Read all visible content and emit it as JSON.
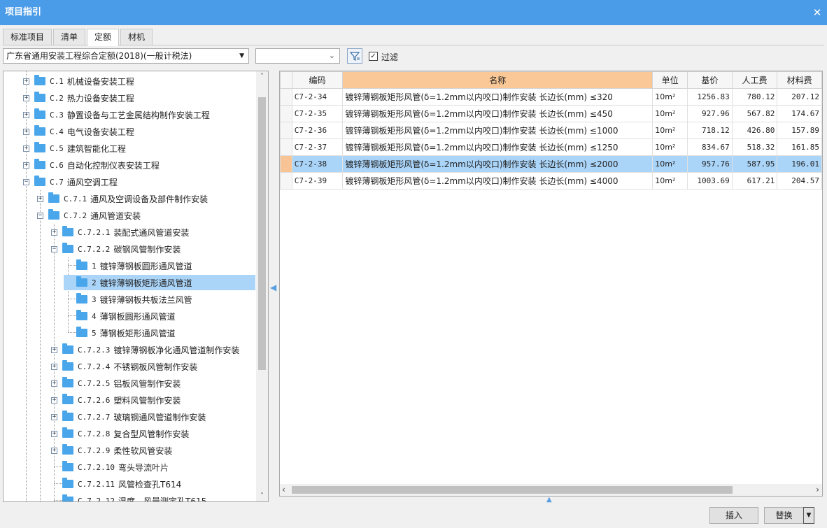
{
  "window": {
    "title": "项目指引",
    "close_glyph": "✕"
  },
  "tabs": [
    {
      "label": "标准项目",
      "active": false
    },
    {
      "label": "清单",
      "active": false
    },
    {
      "label": "定额",
      "active": true
    },
    {
      "label": "材机",
      "active": false
    }
  ],
  "toolbar": {
    "quota_library": "广东省通用安装工程综合定额(2018)(一般计税法)",
    "filter_value": "",
    "filter_checked": true,
    "filter_label": "过滤",
    "filter_icon": "funnel-filter-icon"
  },
  "tree": {
    "nodes": [
      {
        "code": "C.1",
        "label": "机械设备安装工程",
        "expander": "+"
      },
      {
        "code": "C.2",
        "label": "热力设备安装工程",
        "expander": "+"
      },
      {
        "code": "C.3",
        "label": "静置设备与工艺金属结构制作安装工程",
        "expander": "+"
      },
      {
        "code": "C.4",
        "label": "电气设备安装工程",
        "expander": "+"
      },
      {
        "code": "C.5",
        "label": "建筑智能化工程",
        "expander": "+"
      },
      {
        "code": "C.6",
        "label": "自动化控制仪表安装工程",
        "expander": "+"
      },
      {
        "code": "C.7",
        "label": "通风空调工程",
        "expander": "−"
      },
      {
        "code": "C.7.1",
        "label": "通风及空调设备及部件制作安装",
        "expander": "+"
      },
      {
        "code": "C.7.2",
        "label": "通风管道安装",
        "expander": "−"
      },
      {
        "code": "C.7.2.1",
        "label": "装配式通风管道安装",
        "expander": "+"
      },
      {
        "code": "C.7.2.2",
        "label": "碳钢风管制作安装",
        "expander": "−"
      },
      {
        "code": "1",
        "label": "镀锌薄钢板圆形通风管道",
        "expander": ""
      },
      {
        "code": "2",
        "label": "镀锌薄钢板矩形通风管道",
        "expander": ""
      },
      {
        "code": "3",
        "label": "镀锌薄钢板共板法兰风管",
        "expander": ""
      },
      {
        "code": "4",
        "label": "薄钢板圆形通风管道",
        "expander": ""
      },
      {
        "code": "5",
        "label": "薄钢板矩形通风管道",
        "expander": ""
      },
      {
        "code": "C.7.2.3",
        "label": "镀锌薄钢板净化通风管道制作安装",
        "expander": "+"
      },
      {
        "code": "C.7.2.4",
        "label": "不锈钢板风管制作安装",
        "expander": "+"
      },
      {
        "code": "C.7.2.5",
        "label": "铝板风管制作安装",
        "expander": "+"
      },
      {
        "code": "C.7.2.6",
        "label": "塑料风管制作安装",
        "expander": "+"
      },
      {
        "code": "C.7.2.7",
        "label": "玻璃钢通风管道制作安装",
        "expander": "+"
      },
      {
        "code": "C.7.2.8",
        "label": "复合型风管制作安装",
        "expander": "+"
      },
      {
        "code": "C.7.2.9",
        "label": "柔性软风管安装",
        "expander": "+"
      },
      {
        "code": "C.7.2.10",
        "label": "弯头导流叶片",
        "expander": ""
      },
      {
        "code": "C.7.2.11",
        "label": "风管检查孔T614",
        "expander": ""
      },
      {
        "code": "C.7.2.12",
        "label": "温度、风量测定孔T615",
        "expander": ""
      }
    ],
    "selected_index": 12,
    "scroll_up": "˄",
    "scroll_down": "˅"
  },
  "grid": {
    "headers": [
      "编码",
      "名称",
      "单位",
      "基价",
      "人工费",
      "材料费"
    ],
    "rows": [
      {
        "code": "C7-2-34",
        "name": "镀锌薄钢板矩形风管(δ=1.2mm以内咬口)制作安装 长边长(mm) ≤320",
        "unit": "10m²",
        "base_price": "1256.83",
        "labor": "780.12",
        "material": "207.12"
      },
      {
        "code": "C7-2-35",
        "name": "镀锌薄钢板矩形风管(δ=1.2mm以内咬口)制作安装 长边长(mm) ≤450",
        "unit": "10m²",
        "base_price": "927.96",
        "labor": "567.82",
        "material": "174.67"
      },
      {
        "code": "C7-2-36",
        "name": "镀锌薄钢板矩形风管(δ=1.2mm以内咬口)制作安装 长边长(mm) ≤1000",
        "unit": "10m²",
        "base_price": "718.12",
        "labor": "426.80",
        "material": "157.89"
      },
      {
        "code": "C7-2-37",
        "name": "镀锌薄钢板矩形风管(δ=1.2mm以内咬口)制作安装 长边长(mm) ≤1250",
        "unit": "10m²",
        "base_price": "834.67",
        "labor": "518.32",
        "material": "161.85"
      },
      {
        "code": "C7-2-38",
        "name": "镀锌薄钢板矩形风管(δ=1.2mm以内咬口)制作安装 长边长(mm) ≤2000",
        "unit": "10m²",
        "base_price": "957.76",
        "labor": "587.95",
        "material": "196.01"
      },
      {
        "code": "C7-2-39",
        "name": "镀锌薄钢板矩形风管(δ=1.2mm以内咬口)制作安装 长边长(mm) ≤4000",
        "unit": "10m²",
        "base_price": "1003.69",
        "labor": "617.21",
        "material": "204.57"
      }
    ],
    "selected_index": 4,
    "scroll_left": "‹",
    "scroll_right": "›"
  },
  "buttons": {
    "insert": "插入",
    "replace": "替换",
    "replace_drop": "▼"
  },
  "colors": {
    "titlebar": "#4a9be8",
    "selection": "#aad4f8",
    "name_header": "#fac896",
    "folder": "#4aa6ea"
  }
}
